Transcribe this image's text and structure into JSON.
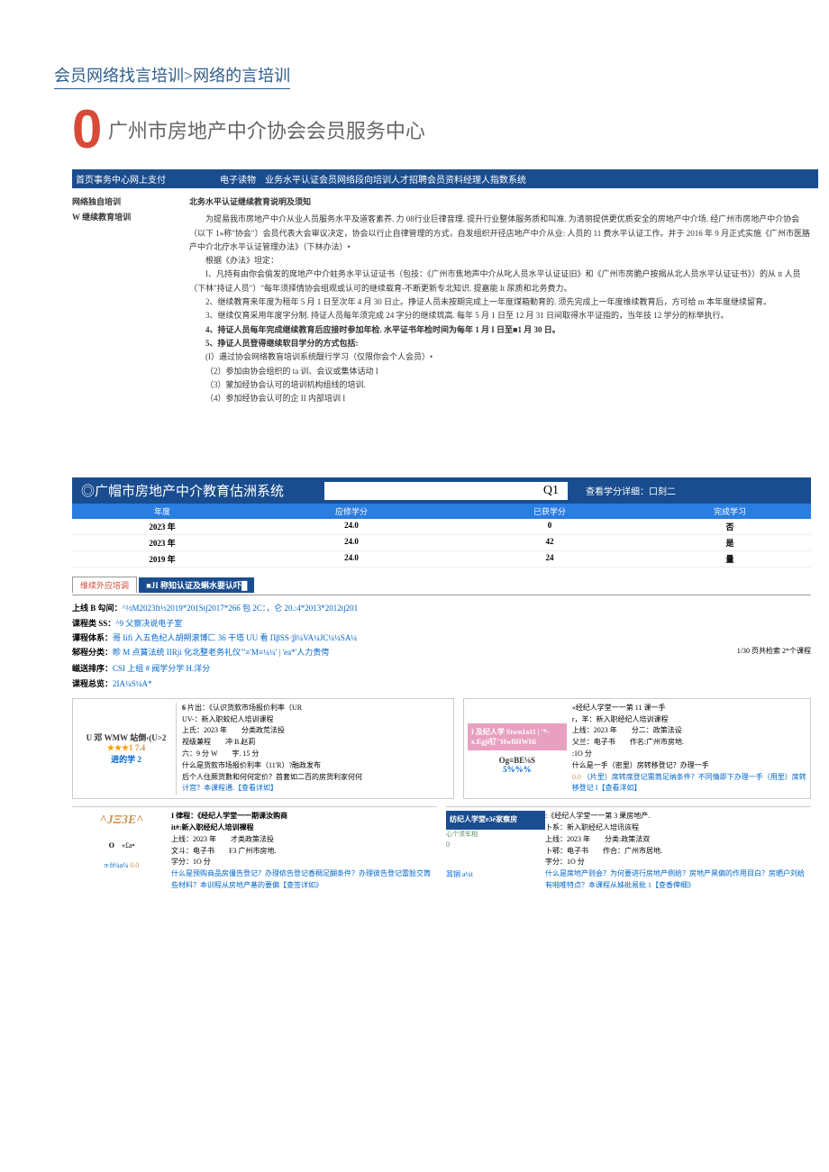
{
  "breadcrumb": {
    "a": "会员网络找言培训",
    "sep": ">",
    "b": "网络的言培训"
  },
  "logo": {
    "o": "0",
    "title": "广州市房地产中介协会会员服务中心"
  },
  "nav": {
    "left": "首页事务中心网上支付",
    "mid": "电子读物",
    "right": "业务水平认证会员网络段向培训人才招聘会员资料经理人指数系统"
  },
  "side": {
    "a": "网络独自培训",
    "b": "W 继续教育培训"
  },
  "notice": {
    "hdr": "北务水平认证继续教育说明及须知",
    "p1": "为提易我市房地产中介从业人员服务水平及道客素养. 力 08行业巨律音理. 提升行业整体服务质和叫准. 为清丽提供更优质安全的房地产中介场. 经广州市房地产中介协会（以下 1»称\"协会\"）会员代表大会审议决定，协会以行止自律管理的方式，自发组织开径店地产中介从业: 人员的 11 费水平认证工作。并于 2016 年 9 月正式实施《广州市医胳产中介北疗水平认证管理办法》（下林办法）•",
    "p2": "根据《办法》坦定：",
    "l1": "I、凡持有由你会偷发的席地产中介蛀务水平认证证书（包技：《广州市焦地声中介从叱人员水平认证证旧》和《广州市房脆户按揭从北人员水平认证证书》）的从 tt 人员（下林\"持证人员\"）\"每年须择情协会组观或认可的继续载育-不断更新专北知识. 提嘉能 It 尿质和北务费力。",
    "l2": "2、继续教育来年度为租年 5 月 1 日至次年 4 月 30 日止。挣证人员未按期完成上一年度煤箱勤育的. 须先完成上一年度维续教育后，方可给 m 本年度继续留育。",
    "l3": "3、继续仅育采用年度字分制. 持证人员每年须完成 24 字分的继续琉高. 每年 5 月 1 日至 12 月 31 日间取得水平证指的，当年技 12 学分的标举执行。",
    "l4": "4、持证人员每年完成继续教育后应接时参加年检. 水平证书年检时间为每年 1 月 I 日至■1 月 30 日。",
    "l5": "5、挣证人员登得继续软目学分的方式包括:",
    "s1": "(I）遇过协会网络教盲培训系统醍行学习（仅限你会个人会员）•",
    "s2": "（2）参加由协会组织的 ta 训、会议或集体话动 I",
    "s3": "（3）蒙加经协会认可的培训机构组线的培训.",
    "s4": "（4）参加经协会认可的企 II 内部培训 I"
  },
  "edu": {
    "title": "◎广帽市房地产中介教育估洲系统",
    "q": "Q1",
    "right": "查看学分详细：口刻二"
  },
  "thdr": {
    "c1": "年度",
    "c2": "应修学分",
    "c3": "已获学分",
    "c4": "完成学习"
  },
  "rows": [
    {
      "c1": "2023 年",
      "c2": "24.0",
      "c3": "0",
      "c4": "否"
    },
    {
      "c1": "2023 年",
      "c2": "24.0",
      "c3": "42",
      "c4": "是"
    },
    {
      "c1": "2019 年",
      "c2": "24.0",
      "c3": "24",
      "c4": "量"
    }
  ],
  "tabs": {
    "a": "维续外应培调",
    "b": "■JI 称知认证及蝌水要认吓█"
  },
  "filters": {
    "f1a": "上线 B 勾间：",
    "f1b": "^½M2023ft½2019*201St∫2017*266 包 2C：，仑 20.:4*2013*2012t∫201",
    "f2a": "课程类 SS：",
    "f2b": "^9 父察决说电子室",
    "f3a": "谭程体系：",
    "f3b": "哥 Iifi 入五色纪人胡朔滚博匚 36 干塔 UU 看 ΠβSS∙¦β¼VA¼JC¼¼SA¼",
    "f4a": "邾程分类：",
    "f4b": "畛 M 点簧法统 IIRji 化北整老务礼仪\"'≡'M≡¼¼' | 'ea*'人力贵俜",
    "f5a": "嵫送排序：",
    "f5b": "CSI 上组 # 阀学分学 H.洋分",
    "f6a": "课程总览：",
    "f6b": "2IA¼S¼A*"
  },
  "pager": "1/30 页共检索 2*个课程",
  "card1": {
    "left": "U 邓 WMW 站倒‹(U>2",
    "num": "6",
    "t": "片出：《认识货款市场报价利率（UR",
    "sub": "UV-：新入职蛟纪人培训课程",
    "r1a": "上氏：2023 年",
    "r1b": "分类政荒法投",
    "r2a": "视级兼程",
    "r2b": "冲 B.赵莉",
    "r3a": "六：9 分 W",
    "r3b": "字. 15 分",
    "q": "什么是货款市场报价利率（11'R）?融政发布",
    "stars": "★★★1",
    "score": "7.4",
    "foot": "后个人住厥货數和何何定价？首套如二百的房货利家何何",
    "bl": "进的学 2",
    "more": "计宫？本课程通.【查看详如】"
  },
  "card2": {
    "pink": "I 及纪人学 Stwn1a11 | '*-x.Egji钌\"HwfiHWHi",
    "g": "Og≡BE⅛S",
    "pc": "5%%%",
    "sc": "0.0",
    "r0": "«经纪人学堂一一第 11 课一手",
    "r0b": "r，羊：新入职经纪人培训课程",
    "r1a": "上线：2023 年",
    "r1b": "分二：政策法设",
    "r2a": "父兰：电子书",
    "r2b": "作名:广州市房地.",
    "r3": ":1O 分",
    "q": "什么是一手（密里）房转移登记？办理一手",
    "q2": "（片里）席转席登记需筒足纳条件？不同情即下办理一手（用里）席转移登记 I【查看洋如】"
  },
  "card3": {
    "gold": "^JΞ3E^",
    "o": "O",
    "ea": "«£a•",
    "pi": "π∙ft¼a¼",
    "sc": "0.0",
    "t": "I 律程：《经纪人学堂一一期课汝购商",
    "sub": "it#:新入职经纪人培训裸程",
    "r1a": "上线：2023 年",
    "r1b": "才类政策法投",
    "r2a": "文斗：电子书",
    "r2b": "F3 广州市房地.",
    "r3": "学分：1O 分",
    "q": "什么是预购商品房僵告登记？办理侬告登记香稠足醐条件？办理彼告登记雷脍交筒些材料？本训程从房地产基的要偏【查签详如》"
  },
  "card4": {
    "blue": "纺纪人学堂e3é家察房",
    "sub2": "心个须车相",
    "z": "0",
    "er": "耳锎 a¼t",
    "r0": ":《经纪人学堂一一第 3 果房地产.",
    "r0b": "卜系：新入职经纪人培讯诙程",
    "r1a": "上线：2023 年",
    "r1b": "分类:政策法双",
    "r2a": "卜鄂：电子书",
    "r2b": "作合：广州市居地.",
    "r3": "字分：1O 分",
    "q": "什么是席地产则会？为何要进行房地产例给？房地产黑偏的作用目白？房晒户刘给有啪唯特点？本课程从姊批易批 1【查香俾细》"
  }
}
